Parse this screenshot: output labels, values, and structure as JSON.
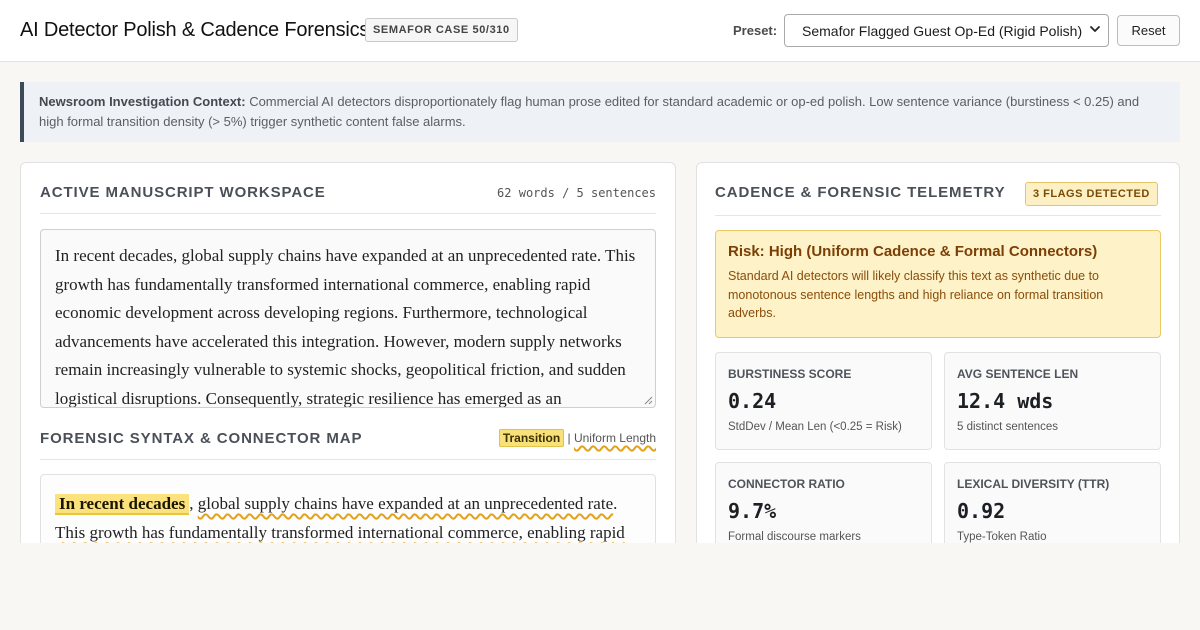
{
  "header": {
    "title": "AI Detector Polish & Cadence Forensics",
    "case_badge": "SEMAFOR CASE 50/310",
    "preset_label": "Preset:",
    "preset_value": "Semafor Flagged Guest Op-Ed (Rigid Polish)",
    "reset_label": "Reset"
  },
  "context": {
    "label": "Newsroom Investigation Context:",
    "text": " Commercial AI detectors disproportionately flag human prose edited for standard academic or op-ed polish. Low sentence variance (burstiness < 0.25) and high formal transition density (> 5%) trigger synthetic content false alarms."
  },
  "workspace": {
    "title": "Active Manuscript Workspace",
    "meta": "62 words / 5 sentences",
    "text": "In recent decades, global supply chains have expanded at an unprecedented rate. This growth has fundamentally transformed international commerce, enabling rapid economic development across developing regions. Furthermore, technological advancements have accelerated this integration. However, modern supply networks remain increasingly vulnerable to systemic shocks, geopolitical friction, and sudden logistical disruptions. Consequently, strategic resilience has emerged as an"
  },
  "syntax_map": {
    "title": "Forensic Syntax & Connector Map",
    "legend_transition": "Transition",
    "legend_sep": " | ",
    "legend_uniform": "Uniform Length",
    "segments": {
      "s1_transition": "In recent decades",
      "s1_comma": ",",
      "s1_rest": "global supply chains have expanded at an unprecedented rate",
      "s1_period": ".",
      "s2_text": "This growth has fundamentally transformed international commerce, enabling rapid"
    }
  },
  "telemetry": {
    "title": "Cadence & Forensic Telemetry",
    "flags_badge": "3 FLAGS DETECTED",
    "risk_title": "Risk: High (Uniform Cadence & Formal Connectors)",
    "risk_text": "Standard AI detectors will likely classify this text as synthetic due to monotonous sentence lengths and high reliance on formal transition adverbs.",
    "metrics": [
      {
        "label": "Burstiness Score",
        "value": "0.24",
        "sub": "StdDev / Mean Len (<0.25 = Risk)"
      },
      {
        "label": "Avg Sentence Len",
        "value": "12.4 wds",
        "sub": "5 distinct sentences"
      },
      {
        "label": "Connector Ratio",
        "value": "9.7%",
        "sub": "Formal discourse markers"
      },
      {
        "label": "Lexical Diversity (TTR)",
        "value": "0.92",
        "sub": "Type-Token Ratio"
      }
    ]
  },
  "colors": {
    "accent_dark": "#3e4a59",
    "transition_highlight": "#fbe27c",
    "uniform_wave": "#e3a21a",
    "risk_bg": "#fdf2c8",
    "risk_text": "#7b3f06"
  }
}
